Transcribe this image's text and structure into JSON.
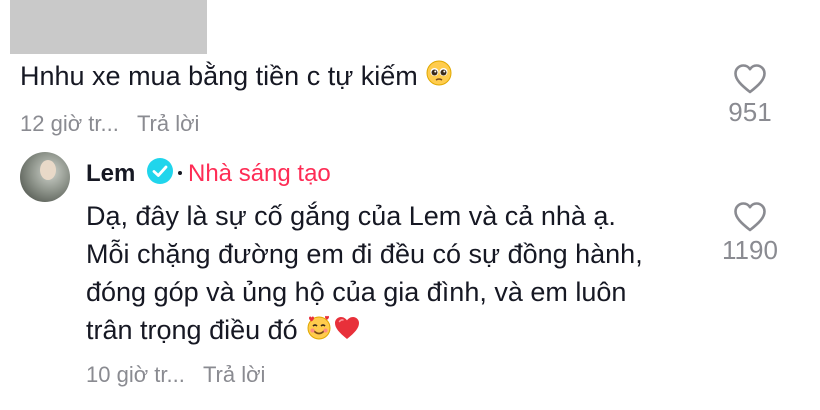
{
  "comment1": {
    "text": "Hnhu xe mua bằng tiền c tự kiếm",
    "emoji_icon": "pleading-face-icon",
    "time": "12 giờ tr...",
    "reply_label": "Trả lời",
    "likes": "951"
  },
  "reply": {
    "author": "Lem",
    "badge": "Nhà sáng tạo",
    "lines": [
      "Dạ, đây là sự cố gắng của Lem và cả nhà ạ.",
      "Mỗi chặng đường em đi đều có sự đồng hành,",
      "đóng góp và ủng hộ của gia đình, và em luôn",
      "trân trọng điều đó"
    ],
    "emoji_icons": [
      "smiling-face-with-hearts-icon",
      "red-heart-icon"
    ],
    "time": "10 giờ tr...",
    "reply_label": "Trả lời",
    "likes": "1190"
  },
  "colors": {
    "text": "#161823",
    "muted": "#8a8b91",
    "creator_badge": "#fe2c55",
    "verified": "#20d5ec"
  }
}
